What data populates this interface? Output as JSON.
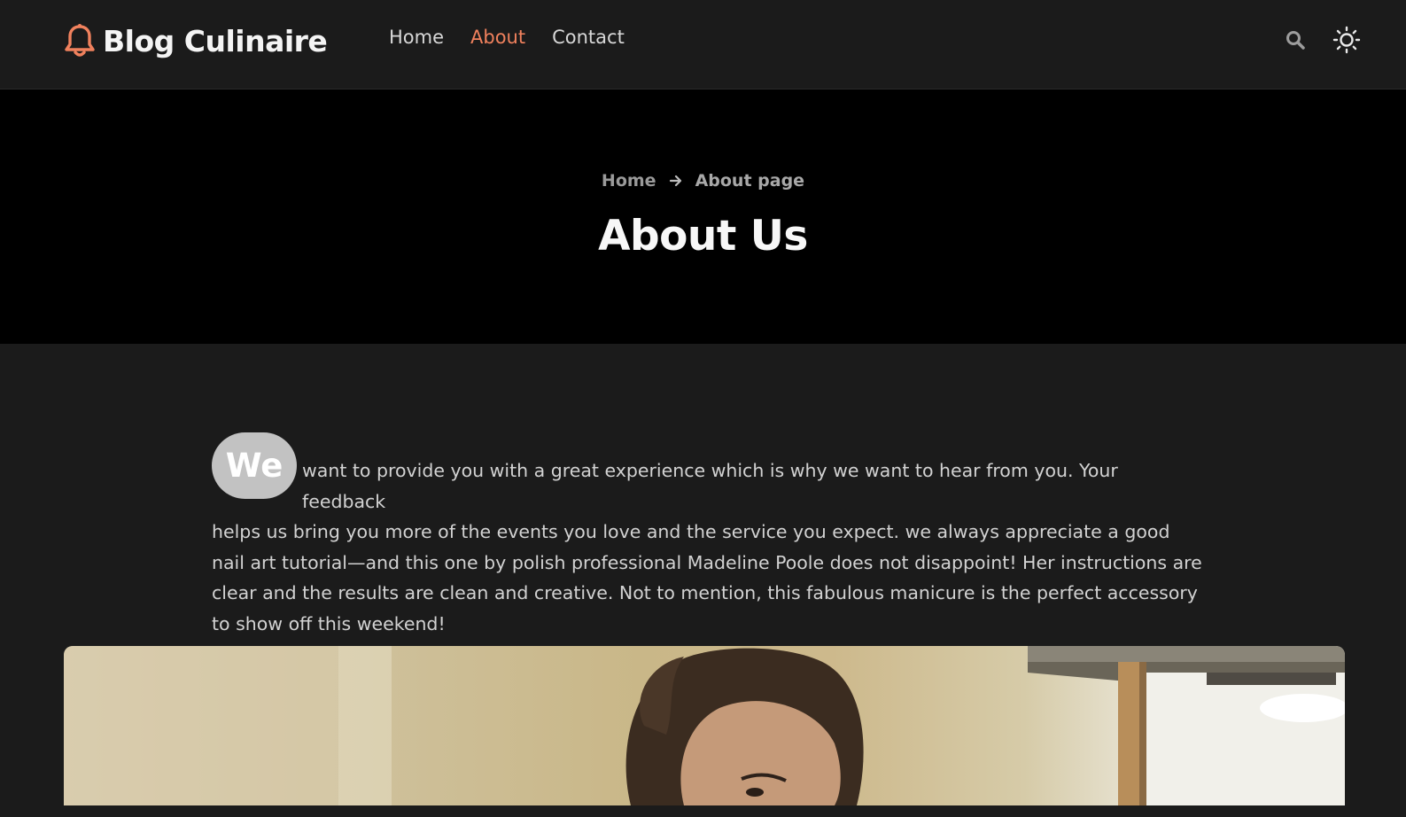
{
  "header": {
    "logo_text": "Blog Culinaire",
    "nav": [
      {
        "label": "Home",
        "active": false
      },
      {
        "label": "About",
        "active": true
      },
      {
        "label": "Contact",
        "active": false
      }
    ],
    "icons": {
      "logo": "bell-icon",
      "search": "search-icon",
      "theme": "sun-icon"
    },
    "accent_color": "#f0815d"
  },
  "hero": {
    "breadcrumb": {
      "home": "Home",
      "current": "About page"
    },
    "title": "About Us"
  },
  "content": {
    "dropcap": "We",
    "first_line": "want to provide you with a great experience which is why we want to hear from you. Your feedback",
    "rest": "helps us bring you more of the events you love and the service you expect. we always appreciate a good nail art tutorial—and this one by polish professional Madeline Poole does not disappoint! Her instructions are clear and the results are clean and creative. Not to mention, this fabulous manicure is the perfect accessory to show off this weekend!"
  }
}
